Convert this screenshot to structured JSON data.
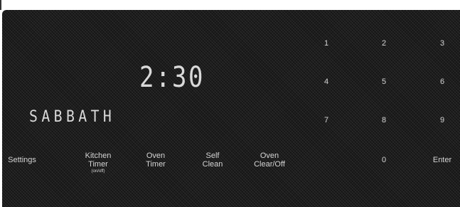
{
  "display": {
    "clock": "2:30",
    "mode": "SABBATH"
  },
  "keypad": {
    "digits": [
      "1",
      "2",
      "3",
      "4",
      "5",
      "6",
      "7",
      "8",
      "9",
      "0"
    ],
    "enter": "Enter"
  },
  "function_keys": {
    "settings": "Settings",
    "kitchen_timer_line1": "Kitchen",
    "kitchen_timer_line2": "Timer",
    "kitchen_timer_sub": "(on/off)",
    "oven_timer_line1": "Oven",
    "oven_timer_line2": "Timer",
    "self_clean_line1": "Self",
    "self_clean_line2": "Clean",
    "oven_clear_line1": "Oven",
    "oven_clear_line2": "Clear/Off"
  }
}
